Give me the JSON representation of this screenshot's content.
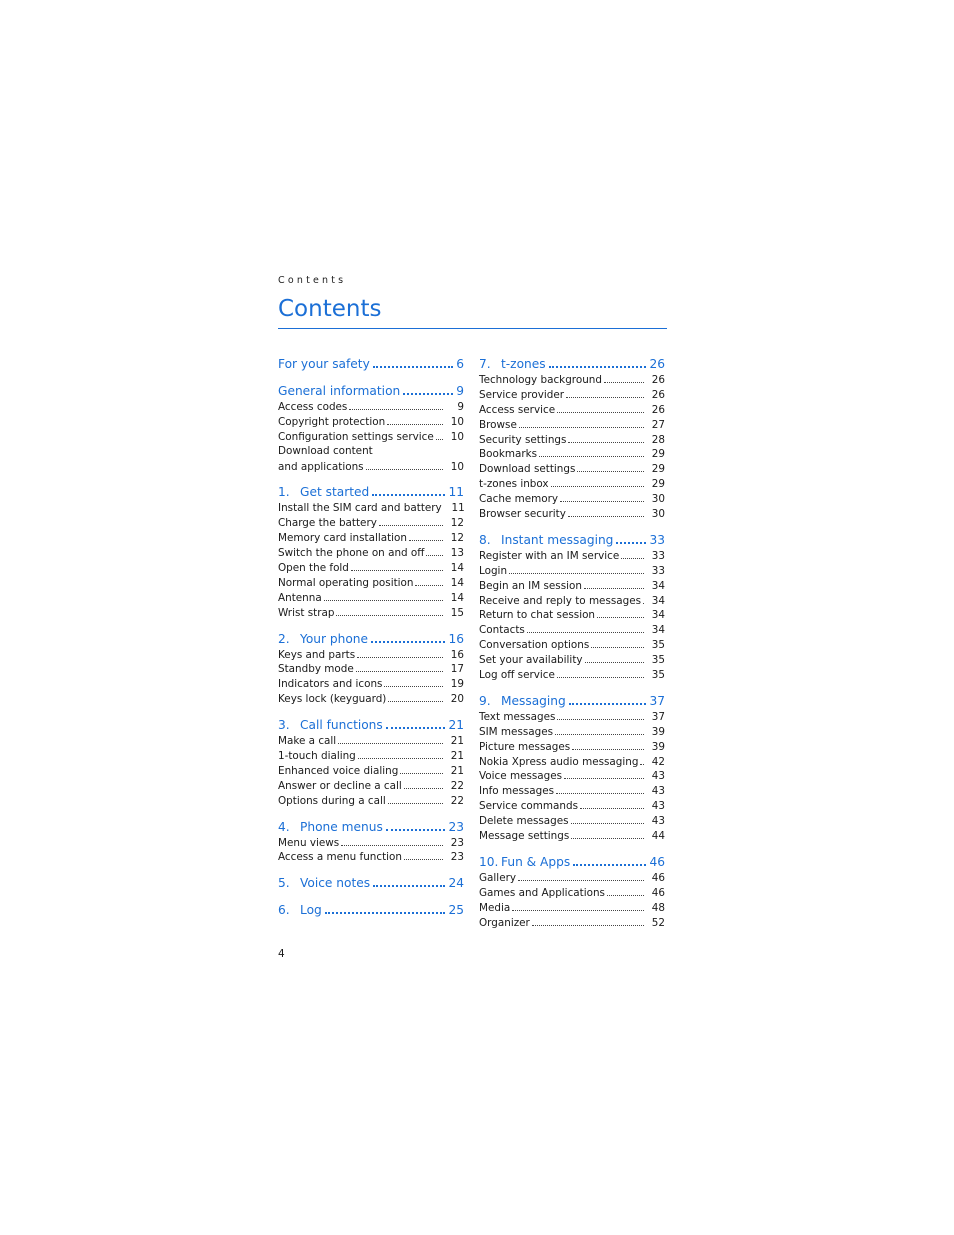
{
  "running_head": "Contents",
  "title": "Contents",
  "page_number": "4",
  "accent_color": "#1b6fd6",
  "left_column": [
    {
      "num": "",
      "label": "For your safety",
      "page": "6",
      "entries": []
    },
    {
      "num": "",
      "label": "General information",
      "page": "9",
      "entries": [
        {
          "label": "Access codes",
          "page": "9"
        },
        {
          "label": "Copyright protection",
          "page": "10"
        },
        {
          "label": "Configuration settings service",
          "page": "10"
        },
        {
          "label": "Download content",
          "page": ""
        },
        {
          "label": "and applications",
          "page": "10"
        }
      ]
    },
    {
      "num": "1.",
      "label": "Get started",
      "page": "11",
      "entries": [
        {
          "label": "Install the SIM card and battery",
          "page": "11"
        },
        {
          "label": "Charge the battery",
          "page": "12"
        },
        {
          "label": "Memory card installation",
          "page": "12"
        },
        {
          "label": "Switch the phone on and off",
          "page": "13"
        },
        {
          "label": "Open the fold",
          "page": "14"
        },
        {
          "label": "Normal operating position",
          "page": "14"
        },
        {
          "label": "Antenna",
          "page": "14"
        },
        {
          "label": "Wrist strap",
          "page": "15"
        }
      ]
    },
    {
      "num": "2.",
      "label": "Your phone",
      "page": "16",
      "entries": [
        {
          "label": "Keys and parts",
          "page": "16"
        },
        {
          "label": "Standby mode",
          "page": "17"
        },
        {
          "label": "Indicators and icons",
          "page": "19"
        },
        {
          "label": "Keys lock (keyguard)",
          "page": "20"
        }
      ]
    },
    {
      "num": "3.",
      "label": "Call functions",
      "page": "21",
      "entries": [
        {
          "label": "Make a call",
          "page": "21"
        },
        {
          "label": "1-touch dialing",
          "page": "21"
        },
        {
          "label": "Enhanced voice dialing",
          "page": "21"
        },
        {
          "label": "Answer or decline a call",
          "page": "22"
        },
        {
          "label": "Options during a call",
          "page": "22"
        }
      ]
    },
    {
      "num": "4.",
      "label": "Phone menus",
      "page": "23",
      "entries": [
        {
          "label": "Menu views",
          "page": "23"
        },
        {
          "label": "Access a menu function",
          "page": "23"
        }
      ]
    },
    {
      "num": "5.",
      "label": "Voice notes",
      "page": "24",
      "entries": []
    },
    {
      "num": "6.",
      "label": "Log",
      "page": "25",
      "entries": []
    }
  ],
  "right_column": [
    {
      "num": "7.",
      "label": "t-zones",
      "page": "26",
      "entries": [
        {
          "label": "Technology background",
          "page": "26"
        },
        {
          "label": "Service provider",
          "page": "26"
        },
        {
          "label": "Access service",
          "page": "26"
        },
        {
          "label": "Browse",
          "page": "27"
        },
        {
          "label": "Security settings",
          "page": "28"
        },
        {
          "label": "Bookmarks",
          "page": "29"
        },
        {
          "label": "Download settings",
          "page": "29"
        },
        {
          "label": "t-zones inbox",
          "page": "29"
        },
        {
          "label": "Cache memory",
          "page": "30"
        },
        {
          "label": "Browser security",
          "page": "30"
        }
      ]
    },
    {
      "num": "8.",
      "label": "Instant messaging",
      "page": "33",
      "entries": [
        {
          "label": "Register with an IM service",
          "page": "33"
        },
        {
          "label": "Login",
          "page": "33"
        },
        {
          "label": "Begin an IM session",
          "page": "34"
        },
        {
          "label": "Receive and reply to messages",
          "page": "34"
        },
        {
          "label": "Return to chat session",
          "page": "34"
        },
        {
          "label": "Contacts",
          "page": "34"
        },
        {
          "label": "Conversation options",
          "page": "35"
        },
        {
          "label": "Set your availability",
          "page": "35"
        },
        {
          "label": "Log off service",
          "page": "35"
        }
      ]
    },
    {
      "num": "9.",
      "label": "Messaging",
      "page": "37",
      "entries": [
        {
          "label": "Text messages",
          "page": "37"
        },
        {
          "label": "SIM messages",
          "page": "39"
        },
        {
          "label": "Picture messages",
          "page": "39"
        },
        {
          "label": "Nokia Xpress audio messaging",
          "page": "42"
        },
        {
          "label": "Voice messages",
          "page": "43"
        },
        {
          "label": "Info messages",
          "page": "43"
        },
        {
          "label": "Service commands",
          "page": "43"
        },
        {
          "label": "Delete messages",
          "page": "43"
        },
        {
          "label": "Message settings",
          "page": "44"
        }
      ]
    },
    {
      "num": "10.",
      "label": "Fun & Apps",
      "page": "46",
      "entries": [
        {
          "label": "Gallery",
          "page": "46"
        },
        {
          "label": "Games and Applications",
          "page": "46"
        },
        {
          "label": "Media",
          "page": "48"
        },
        {
          "label": "Organizer",
          "page": "52"
        }
      ]
    }
  ]
}
